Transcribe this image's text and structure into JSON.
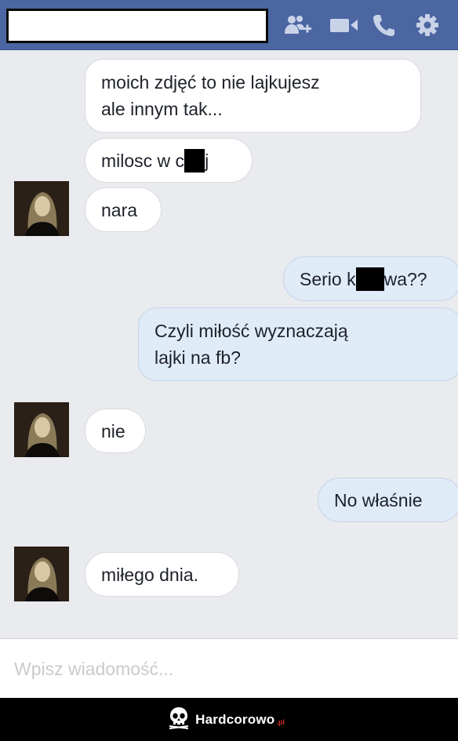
{
  "header": {
    "contact_name": "",
    "icons": [
      "add-friend-icon",
      "video-call-icon",
      "phone-icon",
      "gear-icon"
    ],
    "colors": {
      "bar": "#4b66a1",
      "icon": "#c9d3e8"
    }
  },
  "messages": [
    {
      "from": "other",
      "parts": [
        "moich zdjęć to nie lajkujesz\nale innym tak..."
      ]
    },
    {
      "from": "other",
      "parts": [
        "milosc w c",
        "",
        "j"
      ],
      "redacted": true
    },
    {
      "from": "other",
      "parts": [
        "nara"
      ]
    },
    {
      "from": "me",
      "parts": [
        "Serio k",
        "",
        "wa??"
      ],
      "redacted": true
    },
    {
      "from": "me",
      "parts": [
        "Czyli miłość wyznaczają\nlajki na fb?"
      ]
    },
    {
      "from": "other",
      "parts": [
        "nie"
      ]
    },
    {
      "from": "me",
      "parts": [
        "No właśnie"
      ]
    },
    {
      "from": "other",
      "parts": [
        "miłego dnia."
      ]
    }
  ],
  "composer": {
    "placeholder": "Wpisz wiadomość..."
  },
  "watermark": {
    "brand": "Hardcorowo",
    "suffix": ".pl",
    "logo": "skull-icon"
  },
  "colors": {
    "incoming_bubble": "#ffffff",
    "outgoing_bubble": "#e0ebf8",
    "background": "#e9ebee"
  }
}
